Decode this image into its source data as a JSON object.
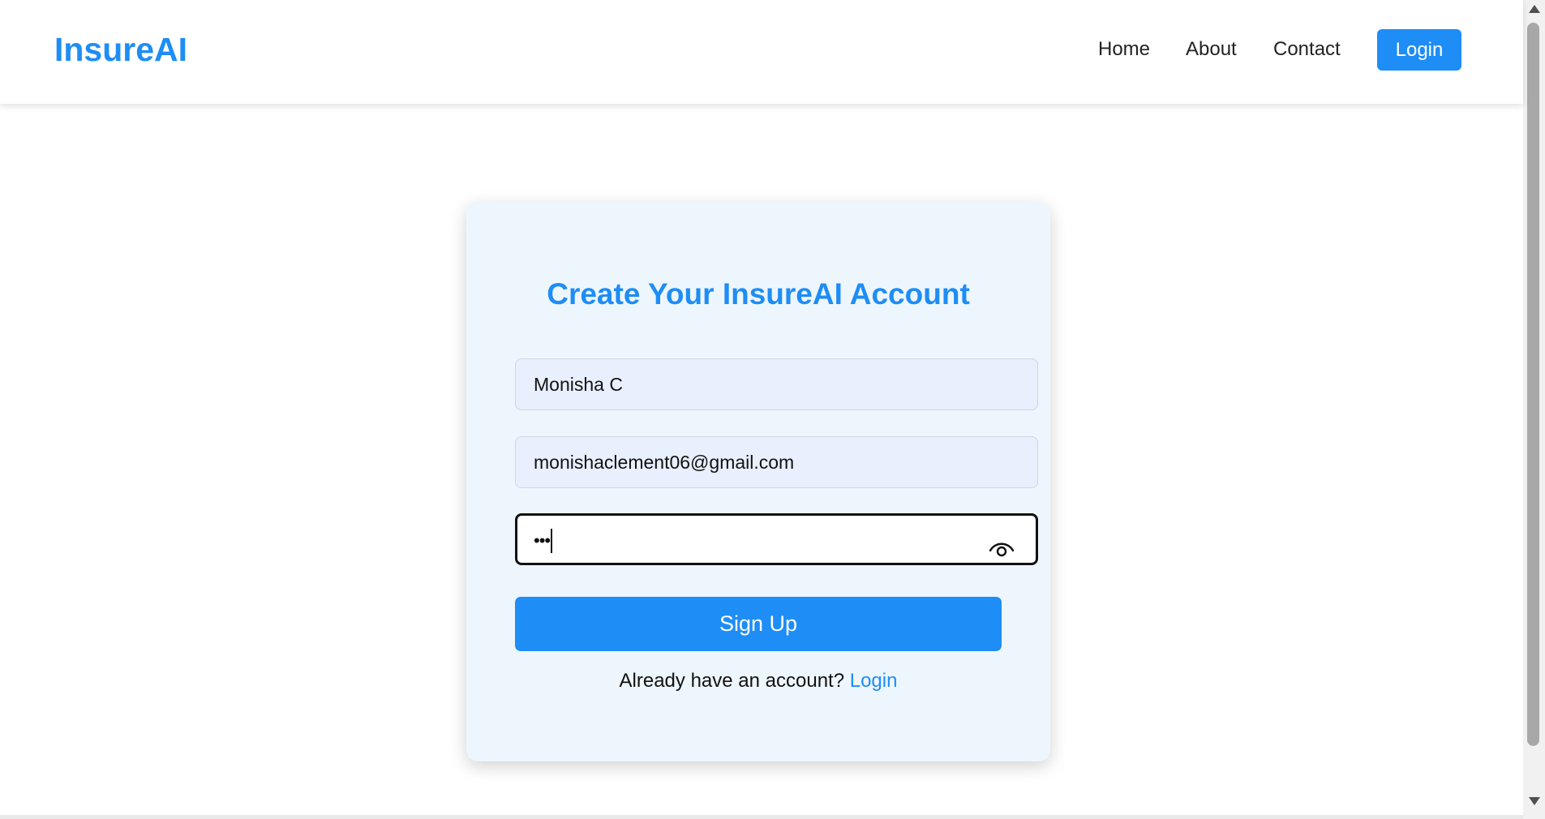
{
  "navbar": {
    "brand": "InsureAI",
    "links": {
      "home": "Home",
      "about": "About",
      "contact": "Contact"
    },
    "login_label": "Login"
  },
  "signup": {
    "title": "Create Your InsureAI Account",
    "name_value": "Monisha C",
    "email_value": "monishaclement06@gmail.com",
    "password_masked": "•••",
    "password_toggle_icon": "eye-icon",
    "submit_label": "Sign Up",
    "footer_text": "Already have an account?",
    "footer_link": "Login"
  },
  "colors": {
    "accent": "#1e8df5",
    "card_bg": "#eef6fd",
    "input_bg": "#e8f0fd"
  }
}
